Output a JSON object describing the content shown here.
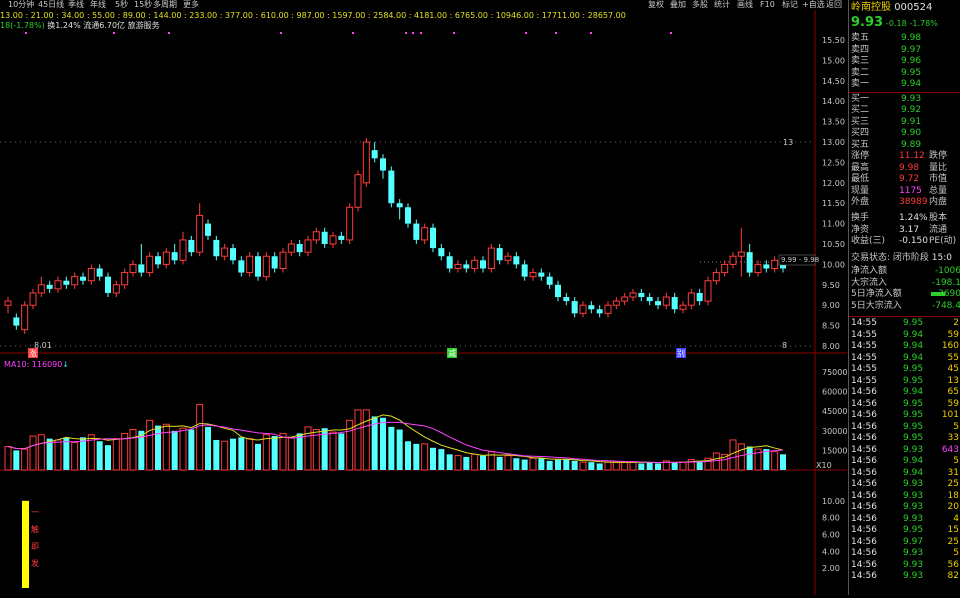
{
  "toolbar": {
    "left": [
      "10分钟",
      "45日线",
      "季线",
      "年线",
      "5秒",
      "15秒",
      "多周期",
      "更多"
    ],
    "right": [
      "复权",
      "叠加",
      "多股",
      "统计",
      "画线",
      "F10",
      "标记",
      "+自选",
      "返回"
    ]
  },
  "fib_line": "13.00 : 21.00 : 34.00 : 55.00 : 89.00 : 144.00 : 233.00 : 377.00 : 610.00 : 987.00 : 1597.00 : 2584.00 : 4181.00 : 6765.00 : 10946.00 : 17711.00 : 28657.00",
  "info_line": {
    "prefix": "18(-1.78%)",
    "turnover": "换1.24%",
    "float": "流通6.70亿",
    "sector": "旅游服务"
  },
  "price_axis": [
    "15.50",
    "15.00",
    "14.50",
    "14.00",
    "13.50",
    "13.00",
    "12.50",
    "12.00",
    "11.50",
    "11.00",
    "10.50",
    "10.00",
    "9.50",
    "9.00",
    "8.50",
    "8.00"
  ],
  "price_labels": {
    "high": "13",
    "low_left": "8.01",
    "low_right": "8",
    "current": "9.99 - 9.98"
  },
  "markers": {
    "zhang": "涨",
    "jian": "减",
    "bie": "别"
  },
  "ma_line": "MA10: 116090",
  "vol_axis": [
    "75000",
    "60000",
    "45000",
    "30000",
    "15000"
  ],
  "vol_unit": "X10",
  "ind_axis": [
    "10.00",
    "8.00",
    "6.00",
    "4.00",
    "2.00"
  ],
  "ind_label": [
    "一",
    "触",
    "即",
    "发"
  ],
  "chart_data": {
    "type": "candlestick",
    "ylim": [
      8.0,
      15.5
    ],
    "candles": [
      [
        9.0,
        9.1,
        8.8,
        9.2
      ],
      [
        8.7,
        8.5,
        8.4,
        8.8
      ],
      [
        8.4,
        9.0,
        8.3,
        9.1
      ],
      [
        9.0,
        9.3,
        8.9,
        9.4
      ],
      [
        9.3,
        9.5,
        9.2,
        9.7
      ],
      [
        9.5,
        9.4,
        9.3,
        9.6
      ],
      [
        9.4,
        9.6,
        9.3,
        9.7
      ],
      [
        9.6,
        9.5,
        9.4,
        9.7
      ],
      [
        9.5,
        9.7,
        9.4,
        9.8
      ],
      [
        9.7,
        9.6,
        9.5,
        9.8
      ],
      [
        9.6,
        9.9,
        9.5,
        10.0
      ],
      [
        9.9,
        9.7,
        9.6,
        10.0
      ],
      [
        9.7,
        9.3,
        9.2,
        9.8
      ],
      [
        9.3,
        9.5,
        9.2,
        9.6
      ],
      [
        9.5,
        9.8,
        9.4,
        9.9
      ],
      [
        9.8,
        10.0,
        9.7,
        10.1
      ],
      [
        10.0,
        9.8,
        9.7,
        10.5
      ],
      [
        9.8,
        10.2,
        9.7,
        10.3
      ],
      [
        10.2,
        10.0,
        9.9,
        10.3
      ],
      [
        10.0,
        10.3,
        9.9,
        10.4
      ],
      [
        10.3,
        10.1,
        10.0,
        10.5
      ],
      [
        10.1,
        10.6,
        10.0,
        10.8
      ],
      [
        10.6,
        10.3,
        10.2,
        10.7
      ],
      [
        10.3,
        11.2,
        10.2,
        11.5
      ],
      [
        11.0,
        10.7,
        10.6,
        11.1
      ],
      [
        10.6,
        10.2,
        10.1,
        10.7
      ],
      [
        10.2,
        10.4,
        10.1,
        10.5
      ],
      [
        10.4,
        10.1,
        10.0,
        10.5
      ],
      [
        10.1,
        9.8,
        9.7,
        10.2
      ],
      [
        9.8,
        10.2,
        9.7,
        10.3
      ],
      [
        10.2,
        9.7,
        9.6,
        10.3
      ],
      [
        9.7,
        10.2,
        9.6,
        10.3
      ],
      [
        10.2,
        9.9,
        9.8,
        10.3
      ],
      [
        9.9,
        10.3,
        9.8,
        10.4
      ],
      [
        10.3,
        10.5,
        10.2,
        10.6
      ],
      [
        10.5,
        10.3,
        10.2,
        10.6
      ],
      [
        10.3,
        10.6,
        10.2,
        10.7
      ],
      [
        10.6,
        10.8,
        10.5,
        10.9
      ],
      [
        10.8,
        10.5,
        10.4,
        10.9
      ],
      [
        10.5,
        10.7,
        10.4,
        10.8
      ],
      [
        10.7,
        10.6,
        10.5,
        10.8
      ],
      [
        10.6,
        11.4,
        10.5,
        11.5
      ],
      [
        11.4,
        12.2,
        11.3,
        12.3
      ],
      [
        12.0,
        13.0,
        11.9,
        13.1
      ],
      [
        12.8,
        12.6,
        12.5,
        13.0
      ],
      [
        12.6,
        12.3,
        12.1,
        12.7
      ],
      [
        12.3,
        11.5,
        11.4,
        12.4
      ],
      [
        11.5,
        11.4,
        11.1,
        11.6
      ],
      [
        11.4,
        11.0,
        10.9,
        11.5
      ],
      [
        11.0,
        10.6,
        10.5,
        11.1
      ],
      [
        10.6,
        10.9,
        10.5,
        11.0
      ],
      [
        10.9,
        10.4,
        10.3,
        11.0
      ],
      [
        10.4,
        10.2,
        10.1,
        10.5
      ],
      [
        10.2,
        9.9,
        9.8,
        10.3
      ],
      [
        9.9,
        10.0,
        9.8,
        10.1
      ],
      [
        10.0,
        9.9,
        9.8,
        10.1
      ],
      [
        9.9,
        10.1,
        9.8,
        10.2
      ],
      [
        10.1,
        9.9,
        9.8,
        10.2
      ],
      [
        9.9,
        10.4,
        9.8,
        10.5
      ],
      [
        10.4,
        10.1,
        10.0,
        10.5
      ],
      [
        10.1,
        10.2,
        10.0,
        10.3
      ],
      [
        10.2,
        10.0,
        9.9,
        10.3
      ],
      [
        10.0,
        9.7,
        9.6,
        10.1
      ],
      [
        9.7,
        9.8,
        9.6,
        9.9
      ],
      [
        9.8,
        9.7,
        9.6,
        9.9
      ],
      [
        9.7,
        9.5,
        9.4,
        9.8
      ],
      [
        9.5,
        9.2,
        9.1,
        9.6
      ],
      [
        9.2,
        9.1,
        9.0,
        9.3
      ],
      [
        9.1,
        8.8,
        8.7,
        9.2
      ],
      [
        8.8,
        9.0,
        8.7,
        9.1
      ],
      [
        9.0,
        8.9,
        8.8,
        9.1
      ],
      [
        8.9,
        8.8,
        8.7,
        9.0
      ],
      [
        8.8,
        9.0,
        8.7,
        9.1
      ],
      [
        9.0,
        9.1,
        8.9,
        9.2
      ],
      [
        9.1,
        9.2,
        9.0,
        9.3
      ],
      [
        9.2,
        9.3,
        9.1,
        9.4
      ],
      [
        9.3,
        9.2,
        9.1,
        9.4
      ],
      [
        9.2,
        9.1,
        9.0,
        9.3
      ],
      [
        9.1,
        9.0,
        8.9,
        9.2
      ],
      [
        9.0,
        9.2,
        8.9,
        9.3
      ],
      [
        9.2,
        8.9,
        8.8,
        9.3
      ],
      [
        8.9,
        9.0,
        8.8,
        9.1
      ],
      [
        9.0,
        9.3,
        8.9,
        9.4
      ],
      [
        9.3,
        9.1,
        9.0,
        9.4
      ],
      [
        9.1,
        9.6,
        9.0,
        9.7
      ],
      [
        9.6,
        9.8,
        9.5,
        9.9
      ],
      [
        9.8,
        10.0,
        9.7,
        10.1
      ],
      [
        10.0,
        10.2,
        9.9,
        10.3
      ],
      [
        10.2,
        10.3,
        9.7,
        10.9
      ],
      [
        10.3,
        9.8,
        9.7,
        10.5
      ],
      [
        9.8,
        10.0,
        9.7,
        10.1
      ],
      [
        10.0,
        9.9,
        9.8,
        10.1
      ],
      [
        9.9,
        10.1,
        9.8,
        10.2
      ],
      [
        10.1,
        9.9,
        9.8,
        10.2
      ]
    ],
    "volumes": [
      180,
      150,
      160,
      260,
      270,
      240,
      230,
      250,
      210,
      250,
      270,
      220,
      190,
      240,
      280,
      310,
      300,
      380,
      340,
      350,
      300,
      320,
      310,
      500,
      330,
      230,
      220,
      240,
      250,
      240,
      200,
      270,
      260,
      280,
      250,
      280,
      330,
      310,
      320,
      290,
      280,
      380,
      460,
      460,
      410,
      400,
      330,
      310,
      220,
      200,
      200,
      170,
      160,
      120,
      110,
      100,
      120,
      110,
      140,
      100,
      110,
      90,
      80,
      90,
      90,
      70,
      80,
      80,
      70,
      60,
      60,
      50,
      60,
      60,
      60,
      60,
      50,
      60,
      50,
      70,
      60,
      60,
      80,
      70,
      90,
      130,
      120,
      230,
      200,
      180,
      160,
      160,
      140,
      120
    ],
    "ind_value": 10.0
  },
  "quote": {
    "name": "岭南控股",
    "code": "000524",
    "price": "9.93",
    "change": "-0.18",
    "pct": "-1.78%",
    "asks": [
      {
        "l": "卖五",
        "p": "9.98"
      },
      {
        "l": "卖四",
        "p": "9.97"
      },
      {
        "l": "卖三",
        "p": "9.96"
      },
      {
        "l": "卖二",
        "p": "9.95"
      },
      {
        "l": "卖一",
        "p": "9.94"
      }
    ],
    "bids": [
      {
        "l": "买一",
        "p": "9.93"
      },
      {
        "l": "买二",
        "p": "9.92"
      },
      {
        "l": "买三",
        "p": "9.91"
      },
      {
        "l": "买四",
        "p": "9.90"
      },
      {
        "l": "买五",
        "p": "9.89"
      }
    ],
    "stats": [
      {
        "l": "涨停",
        "v": "11.12",
        "c": "red",
        "r": "跌停"
      },
      {
        "l": "最高",
        "v": "9.98",
        "c": "red",
        "r": "量比"
      },
      {
        "l": "最低",
        "v": "9.72",
        "c": "red",
        "r": "市值"
      },
      {
        "l": "现量",
        "v": "1175",
        "c": "mag",
        "r": "总量"
      },
      {
        "l": "外盘",
        "v": "38989",
        "c": "red",
        "r": "内盘"
      }
    ],
    "stats2": [
      {
        "l": "换手",
        "v": "1.24%",
        "r": "股本"
      },
      {
        "l": "净资",
        "v": "3.17",
        "r": "流通"
      },
      {
        "l": "收益(三)",
        "v": "-0.150",
        "r": "PE(动)"
      }
    ],
    "trade_state": "交易状态: 闭市阶段",
    "trade_time": "15:0",
    "flows": [
      {
        "l": "净流入额",
        "v": "-1006"
      },
      {
        "l": "大宗流入",
        "v": "-198.1"
      },
      {
        "l": "5日净流入额",
        "v": "-3690"
      },
      {
        "l": "5日大宗流入",
        "v": "-748.4"
      }
    ],
    "ticks": [
      [
        "14:55",
        "9.95",
        "2",
        "g"
      ],
      [
        "14:55",
        "9.94",
        "59",
        "g"
      ],
      [
        "14:55",
        "9.94",
        "160",
        "g"
      ],
      [
        "14:55",
        "9.94",
        "55",
        "g"
      ],
      [
        "14:55",
        "9.95",
        "45",
        "g"
      ],
      [
        "14:55",
        "9.95",
        "13",
        "g"
      ],
      [
        "14:56",
        "9.94",
        "65",
        "g"
      ],
      [
        "14:56",
        "9.95",
        "59",
        "g"
      ],
      [
        "14:56",
        "9.95",
        "101",
        "g"
      ],
      [
        "14:56",
        "9.95",
        "5",
        "g"
      ],
      [
        "14:56",
        "9.95",
        "33",
        "g"
      ],
      [
        "14:56",
        "9.93",
        "643",
        "m"
      ],
      [
        "14:56",
        "9.94",
        "5",
        "g"
      ],
      [
        "14:56",
        "9.94",
        "31",
        "g"
      ],
      [
        "14:56",
        "9.93",
        "25",
        "g"
      ],
      [
        "14:56",
        "9.93",
        "18",
        "g"
      ],
      [
        "14:56",
        "9.93",
        "20",
        "g"
      ],
      [
        "14:56",
        "9.93",
        "4",
        "g"
      ],
      [
        "14:56",
        "9.95",
        "15",
        "g"
      ],
      [
        "14:56",
        "9.97",
        "25",
        "g"
      ],
      [
        "14:56",
        "9.93",
        "5",
        "g"
      ],
      [
        "14:56",
        "9.93",
        "56",
        "g"
      ],
      [
        "14:56",
        "9.93",
        "82",
        "g"
      ]
    ]
  }
}
